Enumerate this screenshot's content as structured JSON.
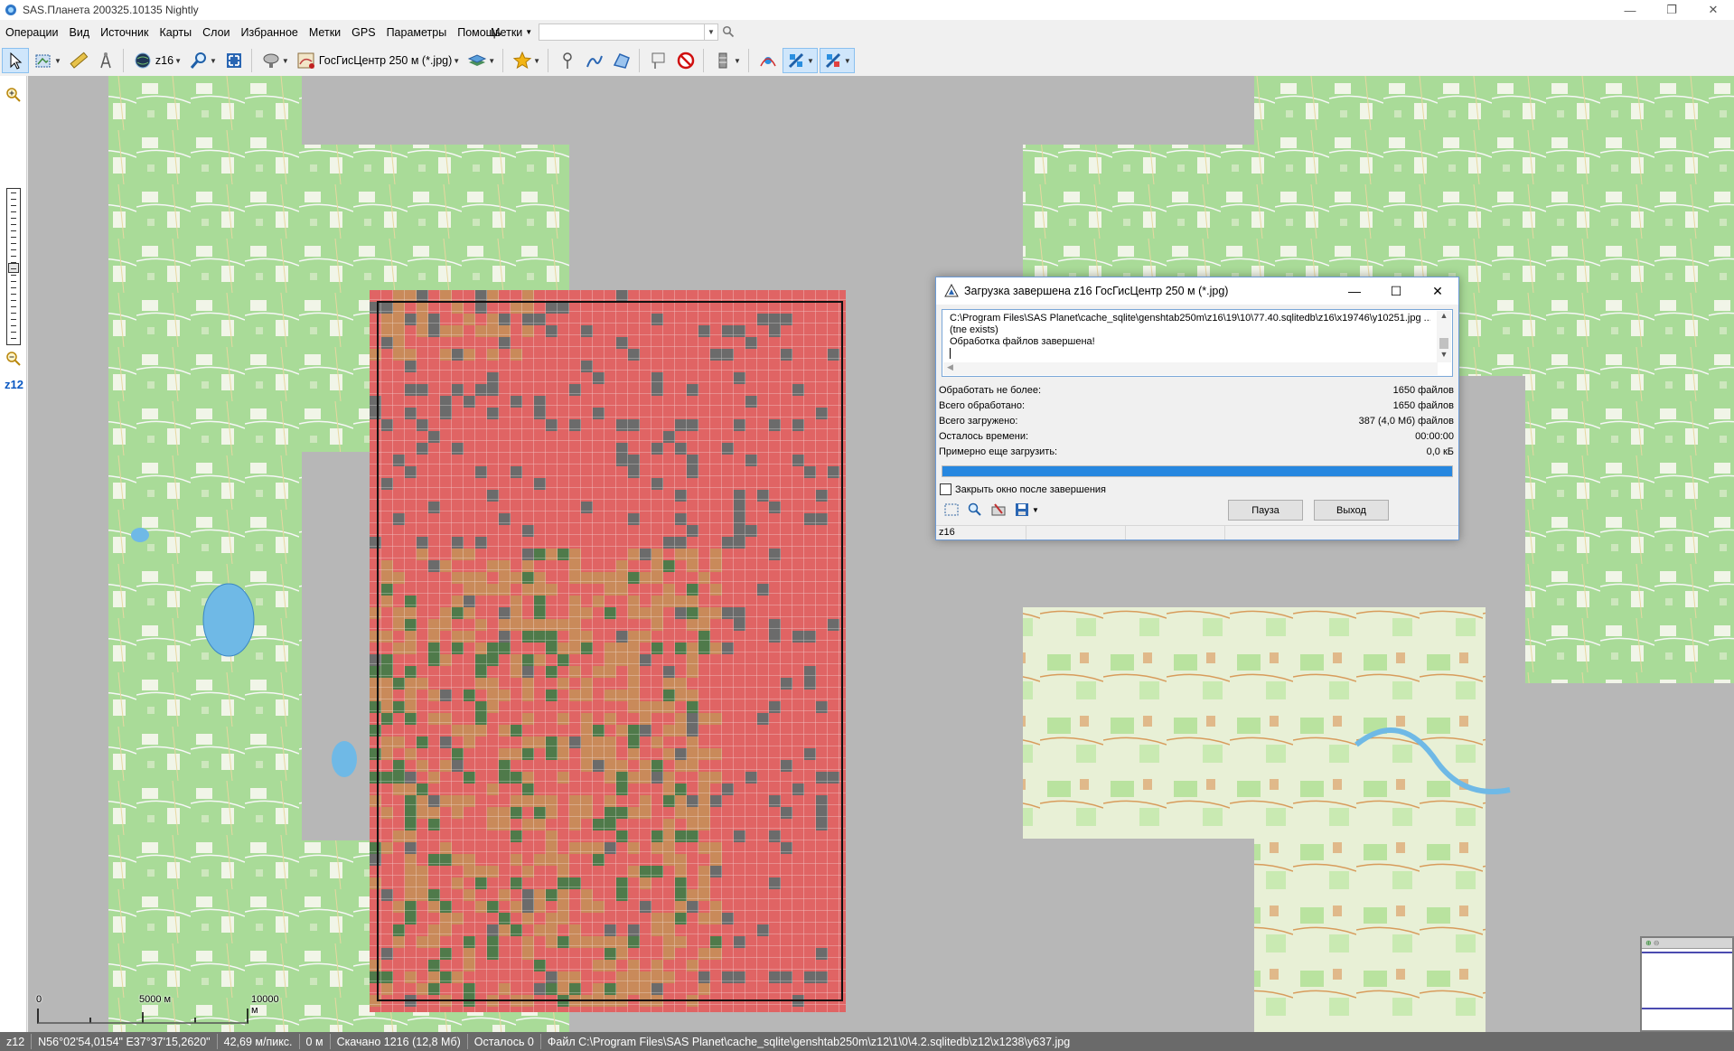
{
  "window": {
    "title": "SAS.Планета 200325.10135 Nightly",
    "minimize": "—",
    "maximize": "❐",
    "close": "✕"
  },
  "menu": [
    "Операции",
    "Вид",
    "Источник",
    "Карты",
    "Слои",
    "Избранное",
    "Метки",
    "GPS",
    "Параметры",
    "Помощь"
  ],
  "marks_dropdown": "Метки",
  "search": {
    "value": "",
    "placeholder": ""
  },
  "toolbar": {
    "zoom_level": "z16",
    "map_source": "ГосГисЦентр 250 м (*.jpg)"
  },
  "zoombar": {
    "level": "z12"
  },
  "scale": {
    "labels": [
      "0",
      "5000 м",
      "10000 м"
    ]
  },
  "dialog": {
    "title": "Загрузка завершена z16 ГосГисЦентр 250 м (*.jpg)",
    "log": [
      "C:\\Program Files\\SAS Planet\\cache_sqlite\\genshtab250m\\z16\\19\\10\\77.40.sqlitedb\\z16\\x19746\\y10251.jpg ...",
      "(tne exists)",
      "Обработка файлов завершена!"
    ],
    "stats": [
      {
        "label": "Обработать не более:",
        "value": "1650 файлов"
      },
      {
        "label": "Всего обработано:",
        "value": "1650 файлов"
      },
      {
        "label": "Всего загружено:",
        "value": "387 (4,0 Мб) файлов"
      },
      {
        "label": "Осталось времени:",
        "value": "00:00:00"
      },
      {
        "label": "Примерно еще загрузить:",
        "value": "0,0 кБ"
      }
    ],
    "progress": 1.0,
    "close_after_label": "Закрыть окно после завершения",
    "pause_label": "Пауза",
    "exit_label": "Выход",
    "status_zoom": "z16"
  },
  "status": {
    "zoom": "z12",
    "coords": "N56°02'54,0154\" E37°37'15,2620\"",
    "resolution": "42,69 м/пикс.",
    "distance": "0 м",
    "downloaded": "Скачано 1216 (12,8 Мб)",
    "remaining": "Осталось 0",
    "file": "Файл C:\\Program Files\\SAS Planet\\cache_sqlite\\genshtab250m\\z12\\1\\0\\4.2.sqlitedb\\z12\\x1238\\y637.jpg"
  },
  "colors": {
    "map_bg": "#b7b7b7",
    "forest": "#9fd48e",
    "field": "#eef3e4",
    "selection_red": "#e06464",
    "tile_dark": "#6b6b6b",
    "tile_green": "#4f7a4a",
    "progress_fill": "#2687e0",
    "accent_blue": "#0a58c2"
  }
}
